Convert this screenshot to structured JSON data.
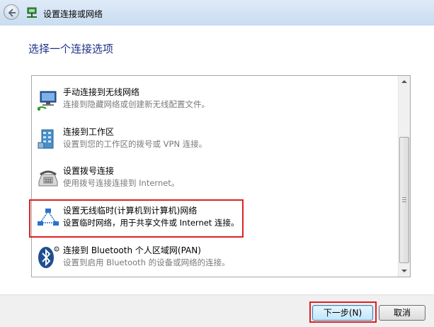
{
  "window": {
    "title": "设置连接或网络"
  },
  "heading": "选择一个连接选项",
  "options": [
    {
      "title": "手动连接到无线网络",
      "desc": "连接到隐藏网络或创建新无线配置文件。",
      "icon": "wireless-network-icon"
    },
    {
      "title": "连接到工作区",
      "desc": "设置到您的工作区的拨号或 VPN 连接。",
      "icon": "workplace-building-icon"
    },
    {
      "title": "设置拨号连接",
      "desc": "使用拨号连接连接到 Internet。",
      "icon": "dialup-phone-icon"
    },
    {
      "title": "设置无线临时(计算机到计算机)网络",
      "desc": "设置临时网络，用于共享文件或 Internet 连接。",
      "icon": "adhoc-network-icon",
      "selected": true
    },
    {
      "title": "连接到 Bluetooth 个人区域网(PAN)",
      "desc": "设置到启用 Bluetooth 的设备或网络的连接。",
      "icon": "bluetooth-icon"
    }
  ],
  "buttons": {
    "next": "下一步(N)",
    "cancel": "取消"
  },
  "colors": {
    "heading": "#1e3287",
    "highlight": "#e02020",
    "selected_bg": "#ffffff"
  }
}
